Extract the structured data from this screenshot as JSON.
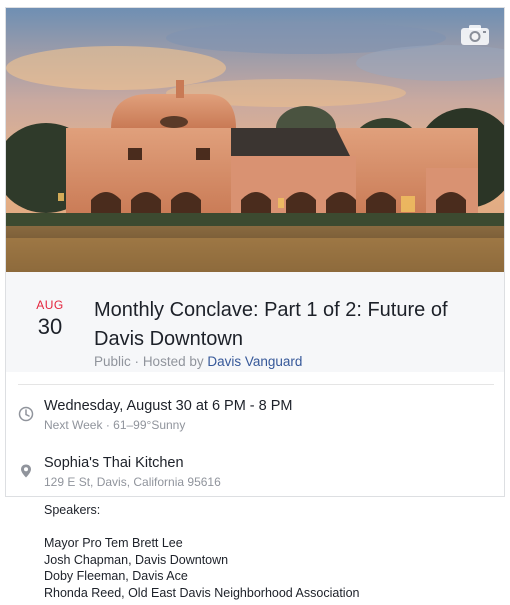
{
  "event": {
    "month": "AUG",
    "day": "30",
    "title": "Monthly Conclave: Part 1 of 2: Future of Davis Downtown",
    "privacy": "Public",
    "hosted_prefix": "Hosted by",
    "host": "Davis Vanguard",
    "separator": "·"
  },
  "time": {
    "primary": "Wednesday, August 30 at 6 PM - 8 PM",
    "relative": "Next Week",
    "weather": "61–99°Sunny"
  },
  "location": {
    "name": "Sophia's Thai Kitchen",
    "address": "129 E St, Davis, California 95616"
  },
  "speakers": {
    "heading": "Speakers:",
    "list": [
      "Mayor Pro Tem Brett Lee",
      "Josh Chapman, Davis Downtown",
      "Doby Fleeman, Davis Ace",
      "Rhonda Reed, Old East Davis Neighborhood Association"
    ]
  },
  "colors": {
    "month_red": "#e4253d",
    "link_blue": "#365899",
    "muted_gray": "#90949c",
    "text_dark": "#1d2129"
  },
  "icons": {
    "cover": "camera-icon",
    "time": "clock-icon",
    "location": "map-pin-icon"
  }
}
